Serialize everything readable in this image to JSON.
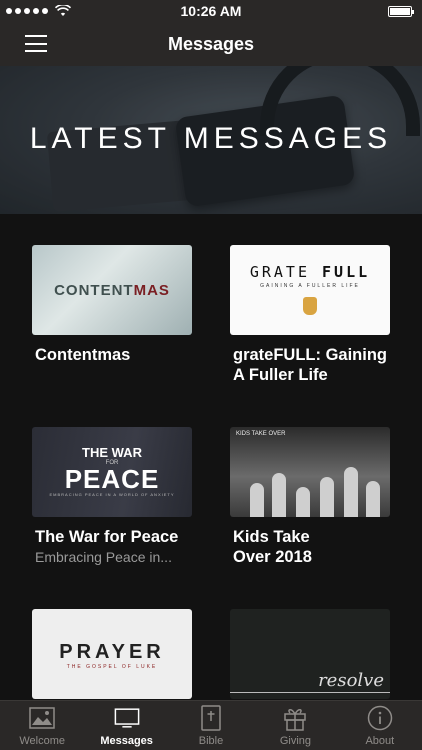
{
  "status": {
    "time": "10:26 AM",
    "battery_level": 1.0
  },
  "nav": {
    "title": "Messages"
  },
  "hero": {
    "title": "LATEST MESSAGES"
  },
  "messages": [
    {
      "title": "Contentmas",
      "subtitle": "",
      "thumb_text": [
        "C",
        "O",
        "NTENT",
        "MAS"
      ]
    },
    {
      "title": "grateFULL: Gaining A Fuller Life",
      "subtitle": "",
      "thumb_text": [
        "GRATE",
        "FULL",
        "GAINING A FULLER LIFE"
      ]
    },
    {
      "title": "The War for Peace",
      "subtitle": "Embracing Peace in...",
      "thumb_text": [
        "THE WAR",
        "FOR",
        "PEACE",
        "EMBRACING PEACE IN A WORLD OF ANXIETY"
      ]
    },
    {
      "title": "Kids Take Over 2018",
      "subtitle": "",
      "thumb_text": [
        "KIDS TAKE OVER"
      ]
    },
    {
      "title": "",
      "subtitle": "",
      "thumb_text": [
        "PRAYER",
        "THE GOSPEL OF LUKE"
      ]
    },
    {
      "title": "",
      "subtitle": "",
      "thumb_text": [
        "resolve"
      ]
    }
  ],
  "tabs": [
    {
      "label": "Welcome",
      "icon": "image-icon",
      "active": false
    },
    {
      "label": "Messages",
      "icon": "monitor-icon",
      "active": true
    },
    {
      "label": "Bible",
      "icon": "bible-icon",
      "active": false
    },
    {
      "label": "Giving",
      "icon": "gift-icon",
      "active": false
    },
    {
      "label": "About",
      "icon": "info-icon",
      "active": false
    }
  ],
  "colors": {
    "bar_bg": "#2a2827",
    "page_bg": "#121212",
    "tab_inactive": "#8f8c89",
    "tab_active": "#ffffff"
  }
}
